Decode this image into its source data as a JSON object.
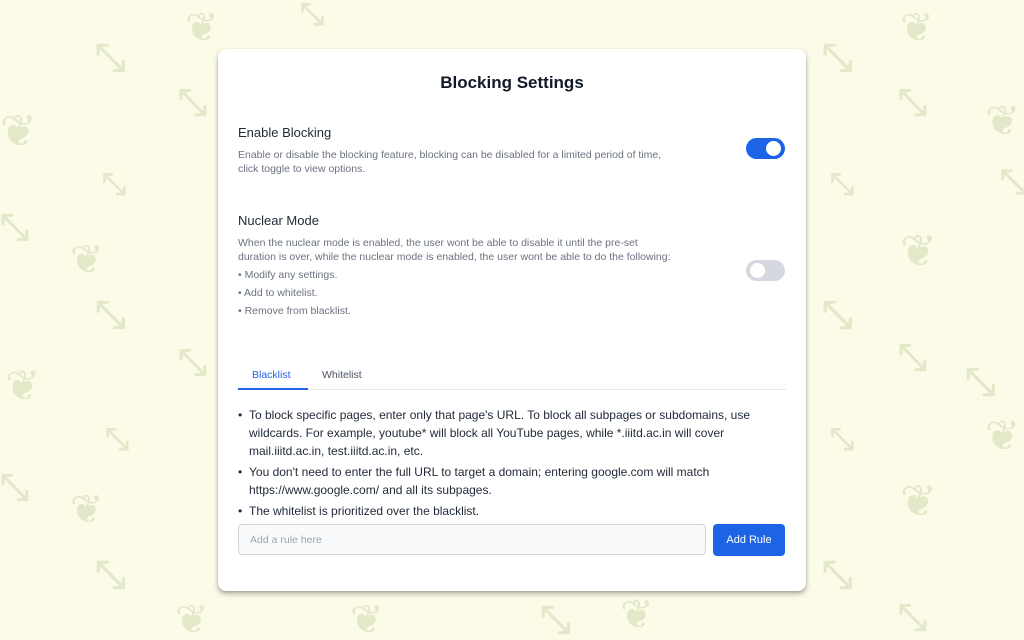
{
  "colors": {
    "background": "#fbfbe8",
    "pattern": "#e3e8c8",
    "accent": "#1d63e6",
    "toggle_off": "#d5d8de"
  },
  "background_pattern": {
    "icons": [
      "compress-arrows-icon",
      "leaf-branch-icon"
    ]
  },
  "settings": {
    "title": "Blocking Settings",
    "enable_blocking": {
      "title": "Enable Blocking",
      "description": "Enable or disable the blocking feature, blocking can be disabled for a limited period of time, click toggle to view options.",
      "enabled": true
    },
    "nuclear_mode": {
      "title": "Nuclear Mode",
      "description": "When the nuclear mode is enabled, the user wont be able to disable it until the pre-set duration is over, while the nuclear mode is enabled, the user wont be able to do the following:",
      "restrictions": [
        "Modify any settings.",
        "Add to whitelist.",
        "Remove from blacklist."
      ],
      "enabled": false
    },
    "tabs": [
      {
        "label": "Blacklist",
        "active": true
      },
      {
        "label": "Whitelist",
        "active": false
      }
    ],
    "info": [
      "To block specific pages, enter only that page's URL. To block all subpages or subdomains, use wildcards. For example, youtube* will block all YouTube pages, while *.iiitd.ac.in will cover mail.iiitd.ac.in, test.iiitd.ac.in, etc.",
      "You don't need to enter the full URL to target a domain; entering google.com will match https://www.google.com/ and all its subpages.",
      "The whitelist is prioritized over the blacklist."
    ],
    "rule_input": {
      "placeholder": "Add a rule here",
      "value": ""
    },
    "add_rule_label": "Add Rule"
  }
}
